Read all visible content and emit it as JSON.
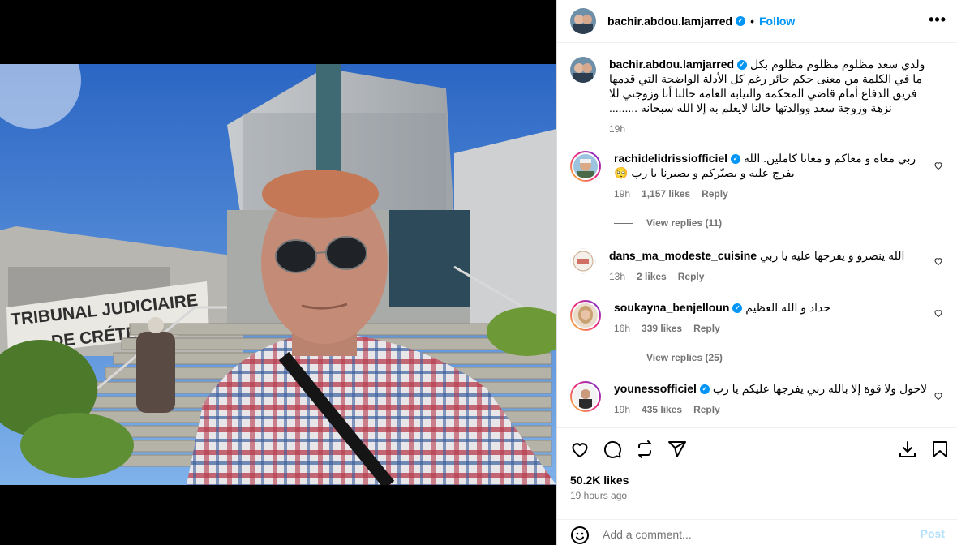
{
  "media": {
    "sign_line1": "TRIBUNAL JUDICIAIRE",
    "sign_line2": "DE CRÉTEIL"
  },
  "post": {
    "username": "bachir.abdou.lamjarred",
    "follow_label": "Follow",
    "more_label": "•••",
    "caption": "ولدي سعد مظلوم مظلوم مظلوم بكل ما في الكلمة من معنى حكم جائر رغم كل الأدلة الواضحة التي قدمها فريق الدفاع أمام قاضي المحكمة والنيابة العامة حالنا أنا وزوجتي للا نزهة وزوجة سعد ووالدتها حالنا لايعلم به إلا الله سبحانه .........",
    "caption_time": "19h",
    "likes": "50.2K likes",
    "time_ago": "19 hours ago"
  },
  "comments": [
    {
      "user": "rachidelidrissiofficiel",
      "verified": true,
      "text": "ربي معاه و معاكم و معانا كاملين. الله يفرج عليه و يصبّركم و يصبرنا يا رب 🥺",
      "time": "19h",
      "likes": "1,157 likes",
      "reply": "Reply",
      "view_replies": "View replies (11)"
    },
    {
      "user": "dans_ma_modeste_cuisine",
      "verified": false,
      "text": "الله ينصرو و يفرجها عليه يا ربي",
      "time": "13h",
      "likes": "2 likes",
      "reply": "Reply"
    },
    {
      "user": "soukayna_benjelloun",
      "verified": true,
      "text": "حداد و الله العظيم",
      "time": "16h",
      "likes": "339 likes",
      "reply": "Reply",
      "view_replies": "View replies (25)"
    },
    {
      "user": "younessofficiel",
      "verified": true,
      "text": "لاحول ولا قوة إلا بالله ربي يفرجها عليكم يا رب",
      "time": "19h",
      "likes": "435 likes",
      "reply": "Reply"
    }
  ],
  "add_comment": {
    "placeholder": "Add a comment...",
    "post_label": "Post"
  },
  "icons": {
    "like": "heart-icon",
    "comment": "comment-icon",
    "repost": "repost-icon",
    "share": "share-icon",
    "save": "bookmark-icon",
    "emoji": "emoji-icon"
  },
  "colors": {
    "accent": "#0095f6",
    "muted": "#737373"
  }
}
